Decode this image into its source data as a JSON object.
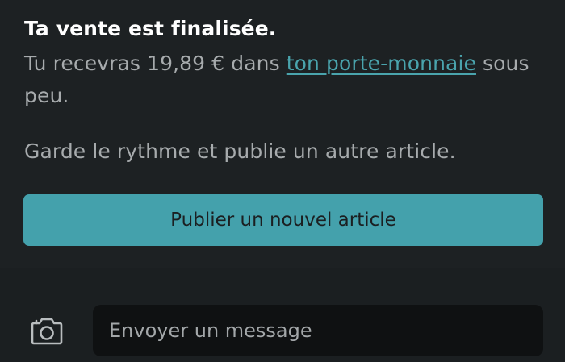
{
  "message": {
    "title": "Ta vente est finalisée.",
    "body_before": "Tu recevras 19,89 € dans ",
    "wallet_link": "ton porte-monnaie",
    "body_after": " sous peu.",
    "encourage": "Garde le rythme et publie un autre article.",
    "publish_button": "Publier un nouvel article"
  },
  "composer": {
    "camera_icon": "camera-icon",
    "placeholder": "Envoyer un message"
  },
  "colors": {
    "background": "#1b1f21",
    "accent": "#44a1ac",
    "link": "#4aa4ad",
    "input_background": "#0f1112"
  }
}
